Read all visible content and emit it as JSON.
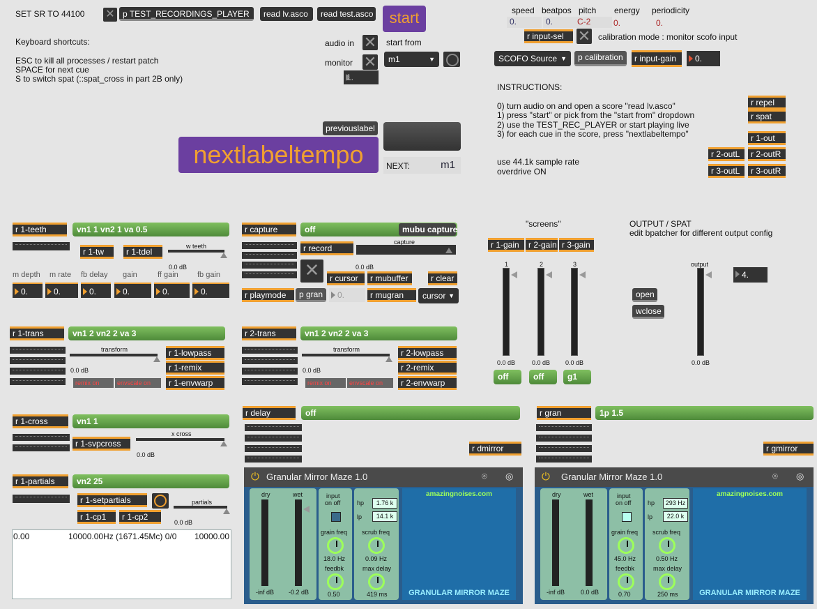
{
  "top": {
    "set_sr": "SET SR TO 44100",
    "player_button": "p TEST_RECORDINGS_PLAYER",
    "read_lv": "read lv.asco",
    "read_test": "read test.asco",
    "start": "start",
    "shortcuts_title": "Keyboard shortcuts:",
    "shortcut_1": "ESC to kill all processes / restart patch",
    "shortcut_2": "SPACE for next cue",
    "shortcut_3": "S to switch spat (::spat_cross in part 2B only)",
    "audio_in": "audio in",
    "monitor": "monitor",
    "monitor_value": "1.",
    "start_from": "start from",
    "start_from_value": "m1",
    "previouslabel": "previouslabel",
    "nextlabeltempo": "nextlabeltempo",
    "next_label": "NEXT:",
    "next_value": "m1"
  },
  "scofo": {
    "speed": "speed",
    "beatpos": "beatpos",
    "pitch": "pitch",
    "energy": "energy",
    "periodicity": "periodicity",
    "speed_val": "0.",
    "beatpos_val": "0.",
    "pitch_val": "C-2",
    "energy_val": "0.",
    "periodicity_val": "0.",
    "input_sel": "r input-sel",
    "calibration_mode": "calibration mode : monitor scofo input",
    "source_menu": "SCOFO Source",
    "p_calibration": "p calibration",
    "input_gain": "r input-gain",
    "gain_val": "0."
  },
  "instructions": {
    "title": "INSTRUCTIONS:",
    "l0": "0) turn audio on and open a score \"read lv.asco\"",
    "l1": "1) press \"start\" or pick from the \"start from\" dropdown",
    "l2": "2) use the TEST_REC_PLAYER or start playing live",
    "l3": "3) for each cue in the score, press \"nextlabeltempo\"",
    "sr": "use 44.1k sample rate",
    "overdrive": "overdrive ON"
  },
  "receives_right": {
    "repel": "r repel",
    "spat": "r spat",
    "out1": "r 1-out",
    "out2l": "r 2-outL",
    "out2r": "r 2-outR",
    "out3l": "r 3-outL",
    "out3r": "r 3-outR"
  },
  "teeth": {
    "recv": "r 1-teeth",
    "bar": "vn1 1 vn2 1 va 0.5",
    "tw": "r 1-tw",
    "tdel": "r 1-tdel",
    "slider_label": "w teeth",
    "db": "0.0 dB",
    "labels": [
      "m depth",
      "m rate",
      "fb delay",
      "gain",
      "ff gain",
      "fb gain"
    ],
    "values": [
      "0.",
      "0.",
      "0.",
      "0.",
      "0.",
      "0."
    ]
  },
  "capture": {
    "recv": "r capture",
    "bar": "off",
    "mubu": "mubu capture",
    "record": "r record",
    "slider_label": "capture",
    "db": "0.0 dB",
    "cursor": "r cursor",
    "mubuffer": "r mubuffer",
    "clear": "r clear",
    "playmode": "r playmode",
    "pgran": "p gran",
    "val": "0.",
    "mugran": "r mugran",
    "cursor_menu": "cursor"
  },
  "screens": {
    "title": "\"screens\"",
    "g1": "r 1-gain",
    "g2": "r 2-gain",
    "g3": "r 3-gain",
    "n1": "1",
    "n2": "2",
    "n3": "3",
    "db1": "0.0 dB",
    "db2": "0.0 dB",
    "db3": "0.0 dB",
    "b1": "off",
    "b2": "off",
    "b3": "g1"
  },
  "output": {
    "title": "OUTPUT / SPAT",
    "subtitle": "edit bpatcher for different output config",
    "label": "output",
    "db": "0.0 dB",
    "val": "4.",
    "open": "open",
    "wclose": "wclose"
  },
  "trans1": {
    "recv": "r 1-trans",
    "bar": "vn1 2 vn2 2 va 3",
    "slider_label": "transform",
    "db": "0.0 dB",
    "lowpass": "r 1-lowpass",
    "remix": "r 1-remix",
    "envwarp": "r 1-envwarp",
    "remix_on": "remix on",
    "envscale_on": "envscale on"
  },
  "trans2": {
    "recv": "r 2-trans",
    "bar": "vn1 2 vn2 2 va 3",
    "slider_label": "transform",
    "db": "0.0 dB",
    "lowpass": "r 2-lowpass",
    "remix": "r 2-remix",
    "envwarp": "r 2-envwarp",
    "remix_on": "remix on",
    "envscale_on": "envscale on"
  },
  "cross": {
    "recv": "r 1-cross",
    "bar": "vn1 1",
    "svpcross": "r 1-svpcross",
    "slider_label": "x cross",
    "db": "0.0 dB"
  },
  "partials": {
    "recv": "r 1-partials",
    "bar": "vn2 25",
    "setpartials": "r 1-setpartials",
    "cp1": "r 1-cp1",
    "cp2": "r 1-cp2",
    "slider_label": "partials",
    "db": "0.0 dB",
    "display_left": "0.00",
    "display_mid": "10000.00Hz (1671.45Mc) 0/0",
    "display_right": "10000.00"
  },
  "delay": {
    "recv": "r delay",
    "bar": "off",
    "mirror": "r dmirror"
  },
  "gran": {
    "recv": "r gran",
    "bar": "1p 1.5",
    "mirror": "r gmirror"
  },
  "device1": {
    "title": "Granular Mirror Maze 1.0",
    "dry": "dry",
    "wet": "wet",
    "input_on": "input",
    "input_off": "on off",
    "hp": "hp",
    "hp_val": "1.76 k",
    "lp": "lp",
    "lp_val": "14.1 k",
    "grain_freq": "grain freq",
    "grain_val": "18.0 Hz",
    "feedbk": "feedbk",
    "feedbk_val": "0.50",
    "scrub": "scrub freq",
    "scrub_val": "0.09 Hz",
    "max_delay": "max delay",
    "max_delay_val": "419 ms",
    "dry_db": "-inf dB",
    "wet_db": "-0.2 dB",
    "site": "amazingnoises.com",
    "brand": "GRANULAR MIRROR MAZE"
  },
  "device2": {
    "title": "Granular Mirror Maze 1.0",
    "dry": "dry",
    "wet": "wet",
    "input_on": "input",
    "input_off": "on off",
    "hp": "hp",
    "hp_val": "293 Hz",
    "lp": "lp",
    "lp_val": "22.0 k",
    "grain_freq": "grain freq",
    "grain_val": "45.0 Hz",
    "feedbk": "feedbk",
    "feedbk_val": "0.70",
    "scrub": "scrub freq",
    "scrub_val": "0.50 Hz",
    "max_delay": "max delay",
    "max_delay_val": "250 ms",
    "dry_db": "-inf dB",
    "wet_db": "0.0 dB",
    "site": "amazingnoises.com",
    "brand": "GRANULAR MIRROR MAZE"
  },
  "colors": {
    "accent": "#f0a030",
    "green": "#5fa048",
    "purple": "#6b3fa0",
    "device_blue": "#1f6ea8"
  }
}
